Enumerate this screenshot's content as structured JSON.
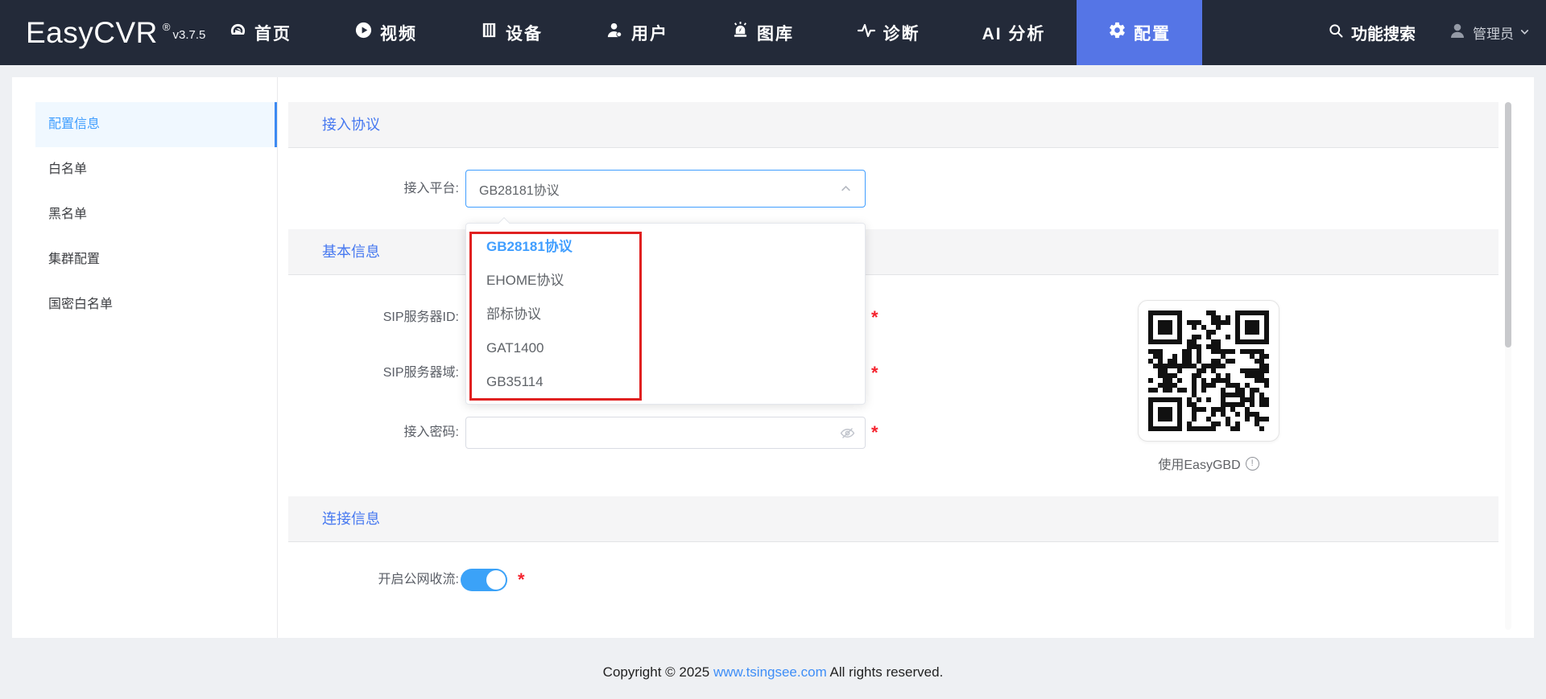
{
  "navbar": {
    "logo": "EasyCVR",
    "registered": "®",
    "version": "v3.7.5",
    "items": [
      {
        "label": "首页",
        "icon": "gauge-icon"
      },
      {
        "label": "视频",
        "icon": "play-circle-icon"
      },
      {
        "label": "设备",
        "icon": "device-icon"
      },
      {
        "label": "用户",
        "icon": "user-icon"
      },
      {
        "label": "图库",
        "icon": "alarm-light-icon"
      },
      {
        "label": "诊断",
        "icon": "pulse-icon"
      },
      {
        "label": "AI 分析",
        "icon": "none"
      },
      {
        "label": "配置",
        "icon": "gear-icon",
        "active": true
      }
    ],
    "search_label": "功能搜索",
    "user_label": "管理员"
  },
  "sidebar": {
    "items": [
      {
        "label": "配置信息",
        "active": true
      },
      {
        "label": "白名单"
      },
      {
        "label": "黑名单"
      },
      {
        "label": "集群配置"
      },
      {
        "label": "国密白名单"
      }
    ]
  },
  "sections": {
    "access_protocol": "接入协议",
    "basic_info": "基本信息",
    "connection_info": "连接信息"
  },
  "form": {
    "platform_label": "接入平台:",
    "platform_value": "GB28181协议",
    "sip_server_id_label": "SIP服务器ID:",
    "sip_server_domain_label": "SIP服务器域:",
    "password_label": "接入密码:",
    "password_value": "",
    "required_mark": "*",
    "public_stream_label": "开启公网收流:",
    "public_stream_on": true
  },
  "dropdown": {
    "options": [
      {
        "label": "GB28181协议",
        "selected": true
      },
      {
        "label": "EHOME协议"
      },
      {
        "label": "部标协议"
      },
      {
        "label": "GAT1400"
      },
      {
        "label": "GB35114"
      }
    ]
  },
  "qr": {
    "caption": "使用EasyGBD"
  },
  "footer": {
    "prefix": "Copyright © 2025",
    "link": "www.tsingsee.com",
    "suffix": "All rights reserved."
  },
  "colors": {
    "navbar_bg": "#232a39",
    "navbar_active": "#5575e6",
    "accent_blue": "#409eff",
    "section_blue": "#4678f0",
    "required_red": "#f5222d",
    "annotation_red": "#e02020",
    "page_bg": "#eef0f3"
  }
}
